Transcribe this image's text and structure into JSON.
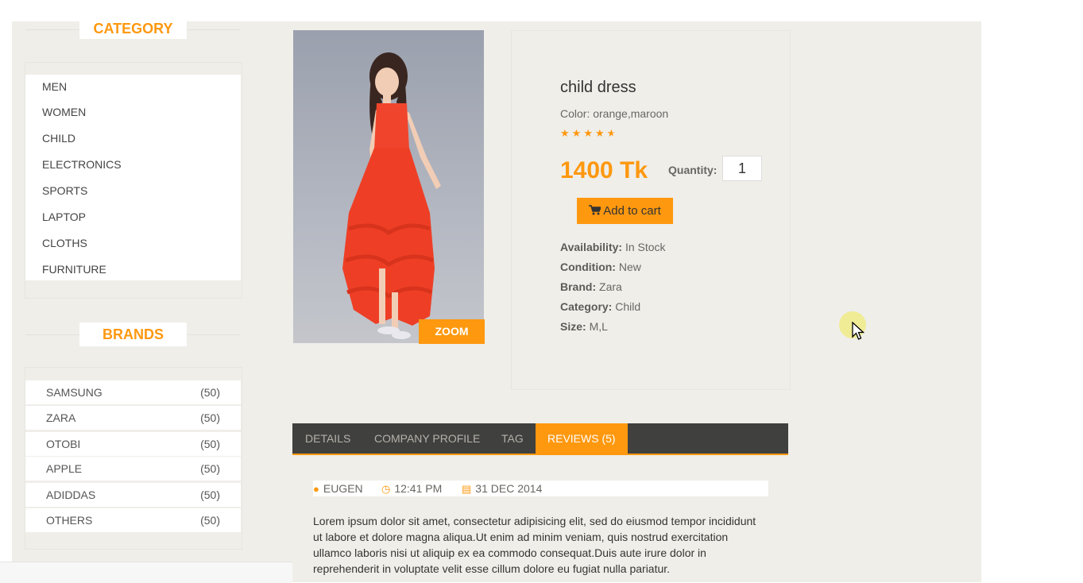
{
  "sidebar": {
    "category_title": "CATEGORY",
    "categories": [
      "MEN",
      "WOMEN",
      "CHILD",
      "ELECTRONICS",
      "SPORTS",
      "LAPTOP",
      "CLOTHS",
      "FURNITURE"
    ],
    "brands_title": "BRANDS",
    "brands": [
      {
        "name": "SAMSUNG",
        "count": "(50)"
      },
      {
        "name": "ZARA",
        "count": "(50)"
      },
      {
        "name": "OTOBI",
        "count": "(50)"
      },
      {
        "name": "APPLE",
        "count": "(50)"
      },
      {
        "name": "ADIDDAS",
        "count": "(50)"
      },
      {
        "name": "OTHERS",
        "count": "(50)"
      }
    ]
  },
  "product": {
    "zoom_label": "ZOOM",
    "name": "child dress",
    "color": "Color: orange,maroon",
    "rating_stars": 4.5,
    "price": "1400 Tk",
    "quantity_label": "Quantity:",
    "quantity_value": "1",
    "add_to_cart_label": "Add to cart",
    "details": [
      {
        "label": "Availability:",
        "value": " In Stock"
      },
      {
        "label": "Condition:",
        "value": " New"
      },
      {
        "label": "Brand:",
        "value": " Zara"
      },
      {
        "label": "Category:",
        "value": " Child"
      },
      {
        "label": "Size:",
        "value": " M,L"
      }
    ]
  },
  "tabs": [
    "DETAILS",
    "COMPANY PROFILE",
    "TAG",
    "REVIEWS (5)"
  ],
  "review": {
    "author": "EUGEN",
    "time": "12:41 PM",
    "date": "31 DEC 2014",
    "text": "Lorem ipsum dolor sit amet, consectetur adipisicing elit, sed do eiusmod tempor incididunt ut labore et dolore magna aliqua.Ut enim ad minim veniam, quis nostrud exercitation ullamco laboris nisi ut aliquip ex ea commodo consequat.Duis aute irure dolor in reprehenderit in voluptate velit esse cillum dolore eu fugiat nulla pariatur."
  },
  "colors": {
    "accent": "#fe980f",
    "tab_bar": "#40403e",
    "page_bg": "#efeee9"
  }
}
